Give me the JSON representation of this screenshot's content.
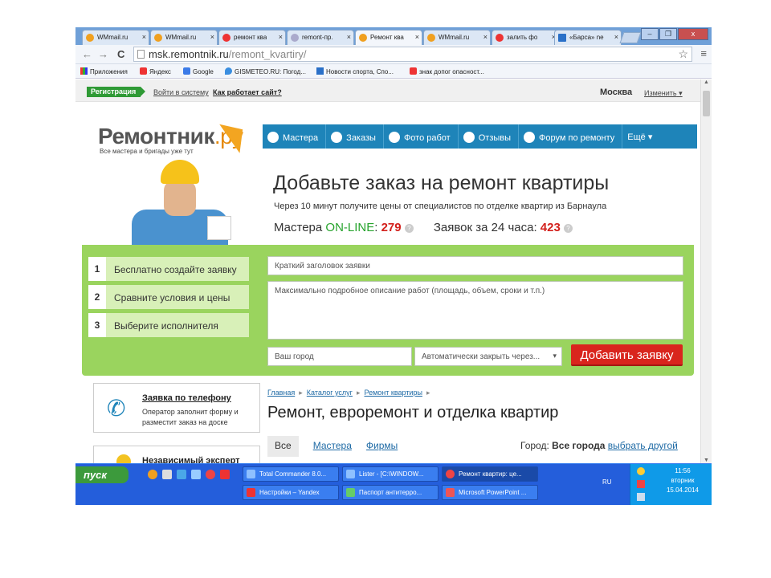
{
  "browser": {
    "tabs": [
      {
        "label": "WMmail.ru",
        "active": false
      },
      {
        "label": "WMmail.ru",
        "active": false
      },
      {
        "label": "ремонт ква",
        "active": false
      },
      {
        "label": "remont-пр.",
        "active": false
      },
      {
        "label": "Ремонт ква",
        "active": true
      },
      {
        "label": "WMmail.ru",
        "active": false
      },
      {
        "label": "залить фо",
        "active": false
      },
      {
        "label": "«Барса» ne",
        "active": false
      }
    ],
    "window_buttons": {
      "minimize": "–",
      "maximize": "❐",
      "close": "x"
    },
    "url_host": "msk.remontnik.ru",
    "url_path": "/remont_kvartiry/",
    "bookmarks": [
      {
        "label": "Приложения",
        "icon": "apps-grid-icon"
      },
      {
        "label": "Яндекс",
        "icon": "yandex-icon"
      },
      {
        "label": "Google",
        "icon": "google-icon"
      },
      {
        "label": "GISMETEO.RU: Погод...",
        "icon": "gismeteo-icon"
      },
      {
        "label": "Новости спорта, Спо...",
        "icon": "sport-news-icon"
      },
      {
        "label": "знак допог опасност...",
        "icon": "yandex-icon"
      }
    ]
  },
  "site": {
    "register": "Регистрация",
    "login": "Войти в систему",
    "how_it_works": "Как работает сайт?",
    "city": "Москва",
    "city_change": "Изменить",
    "logo_main": "Ремонтник",
    "logo_suffix": ".ру",
    "tagline": "Все мастера и бригады уже тут",
    "nav": [
      {
        "label": "Мастера",
        "icon": "masters-icon"
      },
      {
        "label": "Заказы",
        "icon": "orders-icon"
      },
      {
        "label": "Фото работ",
        "icon": "camera-icon"
      },
      {
        "label": "Отзывы",
        "icon": "reviews-icon"
      },
      {
        "label": "Форум по ремонту",
        "icon": "forum-icon"
      },
      {
        "label": "Ещё",
        "icon": "chevron-down-icon"
      }
    ],
    "hero_title": "Добавьте заказ на ремонт квартиры",
    "hero_sub": "Через 10 минут получите цены от специалистов по отделке квартир из Барнаула",
    "stats": {
      "masters_label": "Мастера",
      "online": "ON-LINE",
      "colon": ":",
      "masters_count": "279",
      "requests_label": "Заявок за 24 часа:",
      "requests_count": "423"
    },
    "steps": [
      {
        "n": "1",
        "text": "Бесплатно создайте заявку"
      },
      {
        "n": "2",
        "text": "Сравните условия и цены"
      },
      {
        "n": "3",
        "text": "Выберите исполнителя"
      }
    ],
    "form": {
      "title_placeholder": "Краткий заголовок заявки",
      "desc_placeholder": "Максимально подробное описание работ (площадь, объем, сроки и т.п.)",
      "city_placeholder": "Ваш город",
      "autoclose": "Автоматически закрыть через...",
      "submit": "Добавить заявку"
    },
    "cards": [
      {
        "title": "Заявка по телефону",
        "desc": "Оператор заполнит форму и разместит заказ на доске"
      },
      {
        "title": "Независимый эксперт",
        "desc": ""
      }
    ],
    "breadcrumb": [
      "Главная",
      "Каталог услуг",
      "Ремонт квартиры"
    ],
    "section_title": "Ремонт, евроремонт и отделка квартир",
    "list_tabs": [
      "Все",
      "Мастера",
      "Фирмы"
    ],
    "city_filter_label": "Город:",
    "city_filter_value": "Все города",
    "city_filter_link": "выбрать другой"
  },
  "taskbar": {
    "start": "пуск",
    "windows_row1": [
      "Total Commander 8.0...",
      "Lister - [C:\\WINDOW...",
      "Ремонт квартир: це..."
    ],
    "windows_row2": [
      "Настройки – Yandex",
      "Паспорт антитерро...",
      "Microsoft PowerPoint ..."
    ],
    "lang": "RU",
    "time": "11:56",
    "day": "вторник",
    "date": "15.04.2014"
  }
}
